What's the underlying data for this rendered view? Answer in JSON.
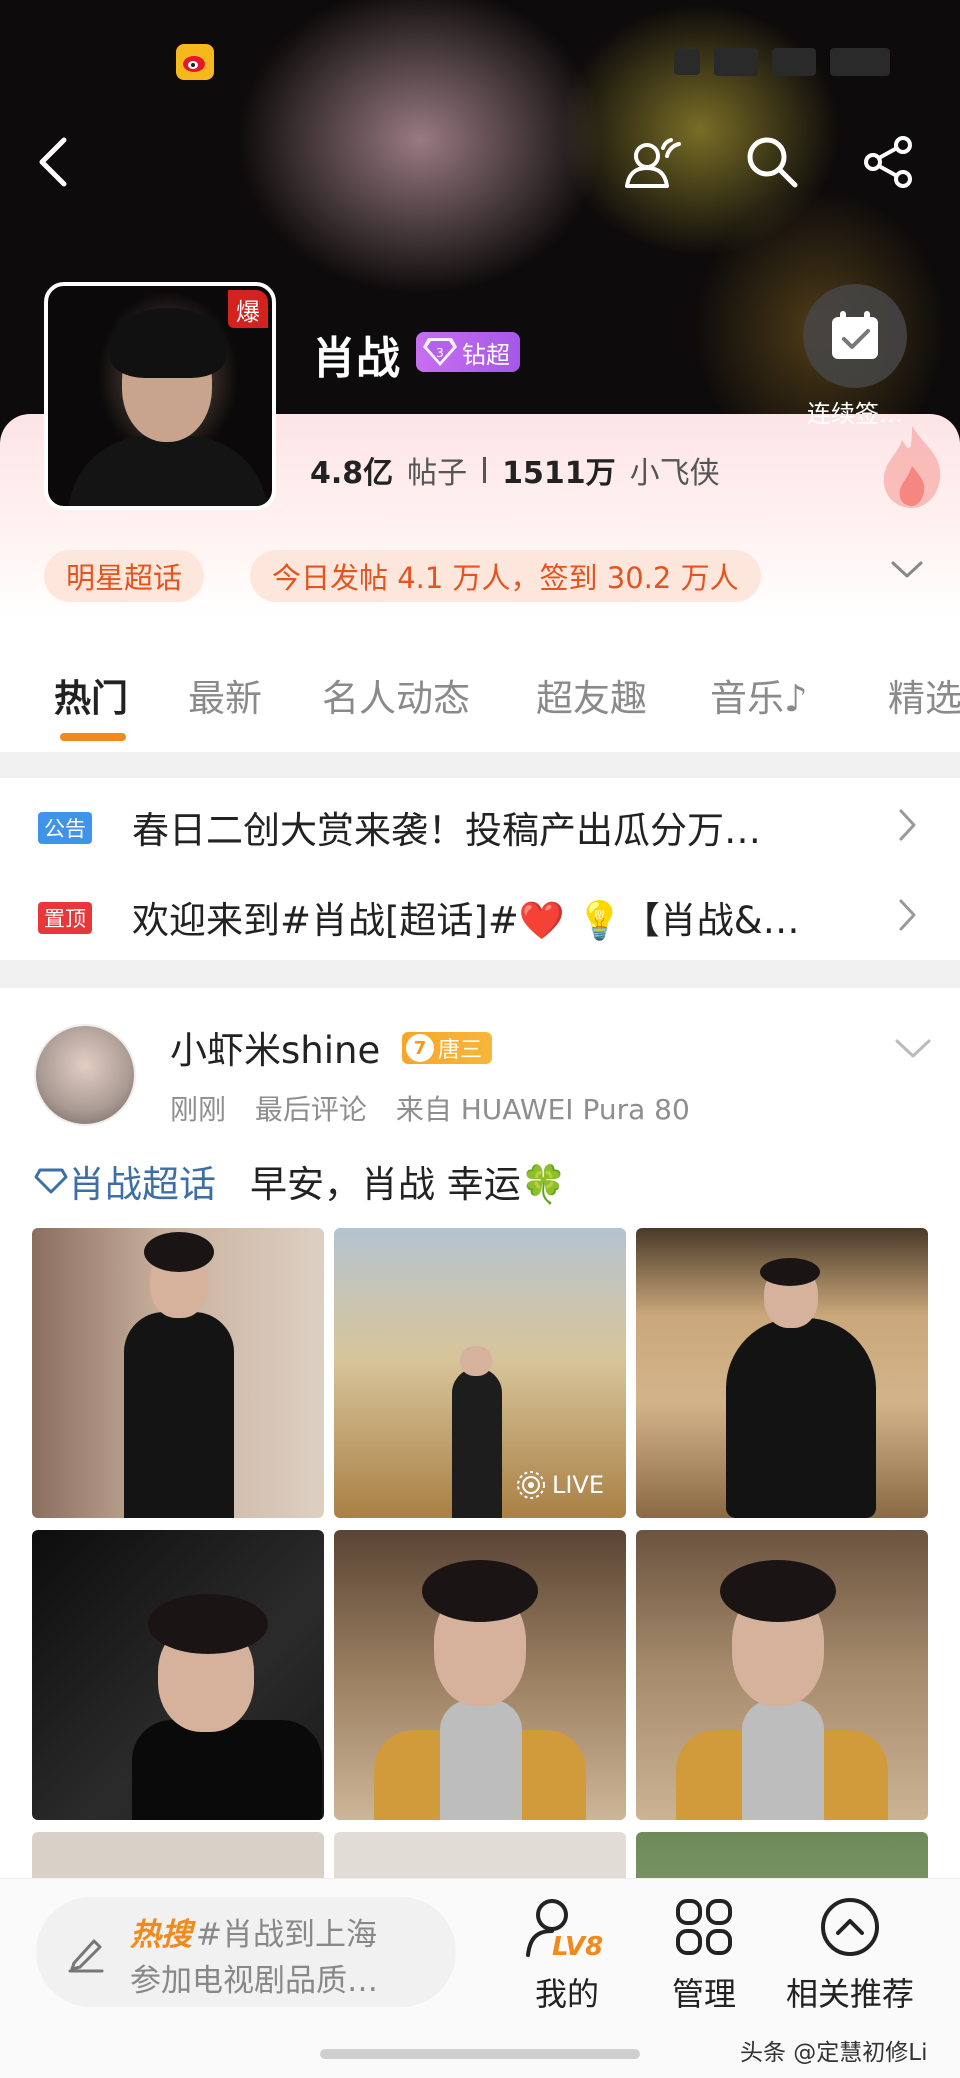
{
  "header": {
    "topic_name": "肖战",
    "badge_label": "钻超",
    "hot_badge": "爆",
    "checkin_label": "连续签…"
  },
  "stats": {
    "posts_count": "4.8亿",
    "posts_label": "帖子",
    "fans_count": "1511万",
    "fans_label": "小飞侠"
  },
  "chips": {
    "category": "明星超话",
    "activity": "今日发帖 4.1 万人，签到 30.2 万人"
  },
  "tabs": [
    {
      "label": "热门"
    },
    {
      "label": "最新"
    },
    {
      "label": "名人动态"
    },
    {
      "label": "超友趣"
    },
    {
      "label": "音乐♪"
    },
    {
      "label": "精选"
    }
  ],
  "notices": [
    {
      "tag": "公告",
      "tag_color": "#3f93e8",
      "text": "春日二创大赏来袭！投稿产出瓜分万…"
    },
    {
      "tag": "置顶",
      "tag_color": "#e8373a",
      "text": "欢迎来到#肖战[超话]#❤️ 💡【肖战&…"
    }
  ],
  "post": {
    "username": "小虾米shine",
    "level": "7",
    "level_title": "唐三",
    "time": "刚刚",
    "last_comment": "最后评论",
    "source": "来自 HUAWEI Pura 80",
    "topic": "肖战超话",
    "text": "早安，肖战 幸运🍀",
    "live_label": "LIVE"
  },
  "bottom_bar": {
    "hot_prefix": "热搜",
    "hot_text_1": "#肖战到上海",
    "hot_text_2": "参加电视剧品质…",
    "nav": [
      {
        "label": "我的",
        "icon": "lv8-icon",
        "badge": "LV8"
      },
      {
        "label": "管理",
        "icon": "grid-icon"
      },
      {
        "label": "相关推荐",
        "icon": "chevron-up-circle-icon"
      }
    ]
  },
  "watermark": "头条 @定慧初修Li",
  "colors": {
    "accent_orange": "#f08a1c",
    "topic_blue": "#3d6ea5",
    "diamond_purple": "#b462ec"
  }
}
